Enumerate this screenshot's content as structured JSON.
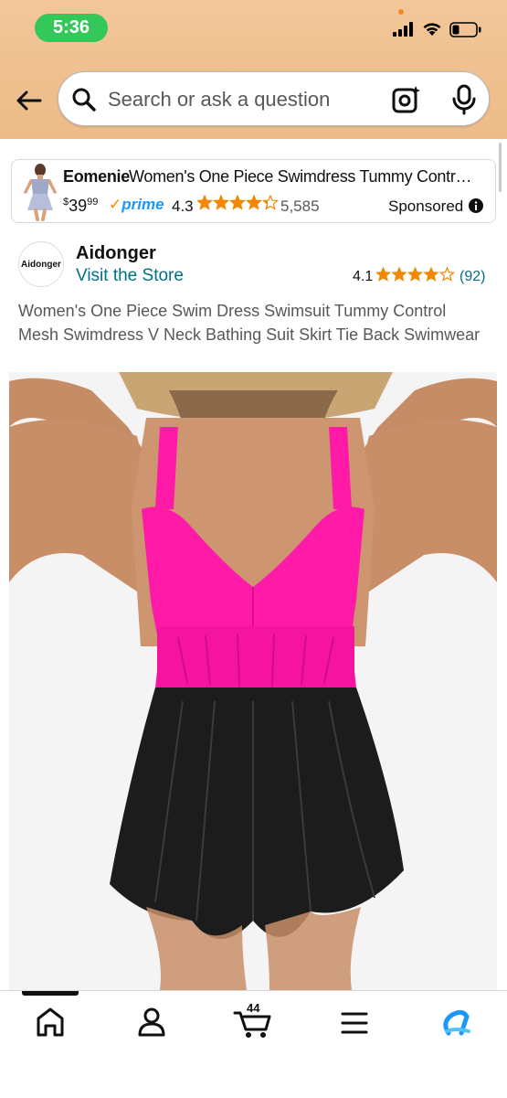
{
  "status": {
    "time": "5:36"
  },
  "search": {
    "placeholder": "Search or ask a question"
  },
  "ad": {
    "brand": "Eomenie",
    "title": "Women's One Piece Swimdress Tummy Control…",
    "price_symbol": "$",
    "price_whole": "39",
    "price_fraction": "99",
    "prime_label": "prime",
    "rating": "4.3",
    "rating_value": 4.3,
    "review_count": "5,585",
    "sponsored_label": "Sponsored"
  },
  "store": {
    "logo_text": "Aidonger",
    "name": "Aidonger",
    "visit_label": "Visit the Store",
    "rating": "4.1",
    "rating_value": 4.1,
    "review_count": "(92)"
  },
  "product": {
    "title": "Women's One Piece Swim Dress Swimsuit Tummy Control Mesh Swimdress V Neck Bathing Suit Skirt Tie Back Swimwear",
    "top_color": "#ff1aa8",
    "skirt_color": "#1c1c1c"
  },
  "nav": {
    "items": [
      "home-icon",
      "account-icon",
      "cart-icon",
      "menu-icon",
      "rufus-icon"
    ],
    "cart_count": "44"
  },
  "colors": {
    "header": "#efc08e",
    "link": "#007185",
    "star": "#f08804",
    "prime": "#1a98ff"
  }
}
